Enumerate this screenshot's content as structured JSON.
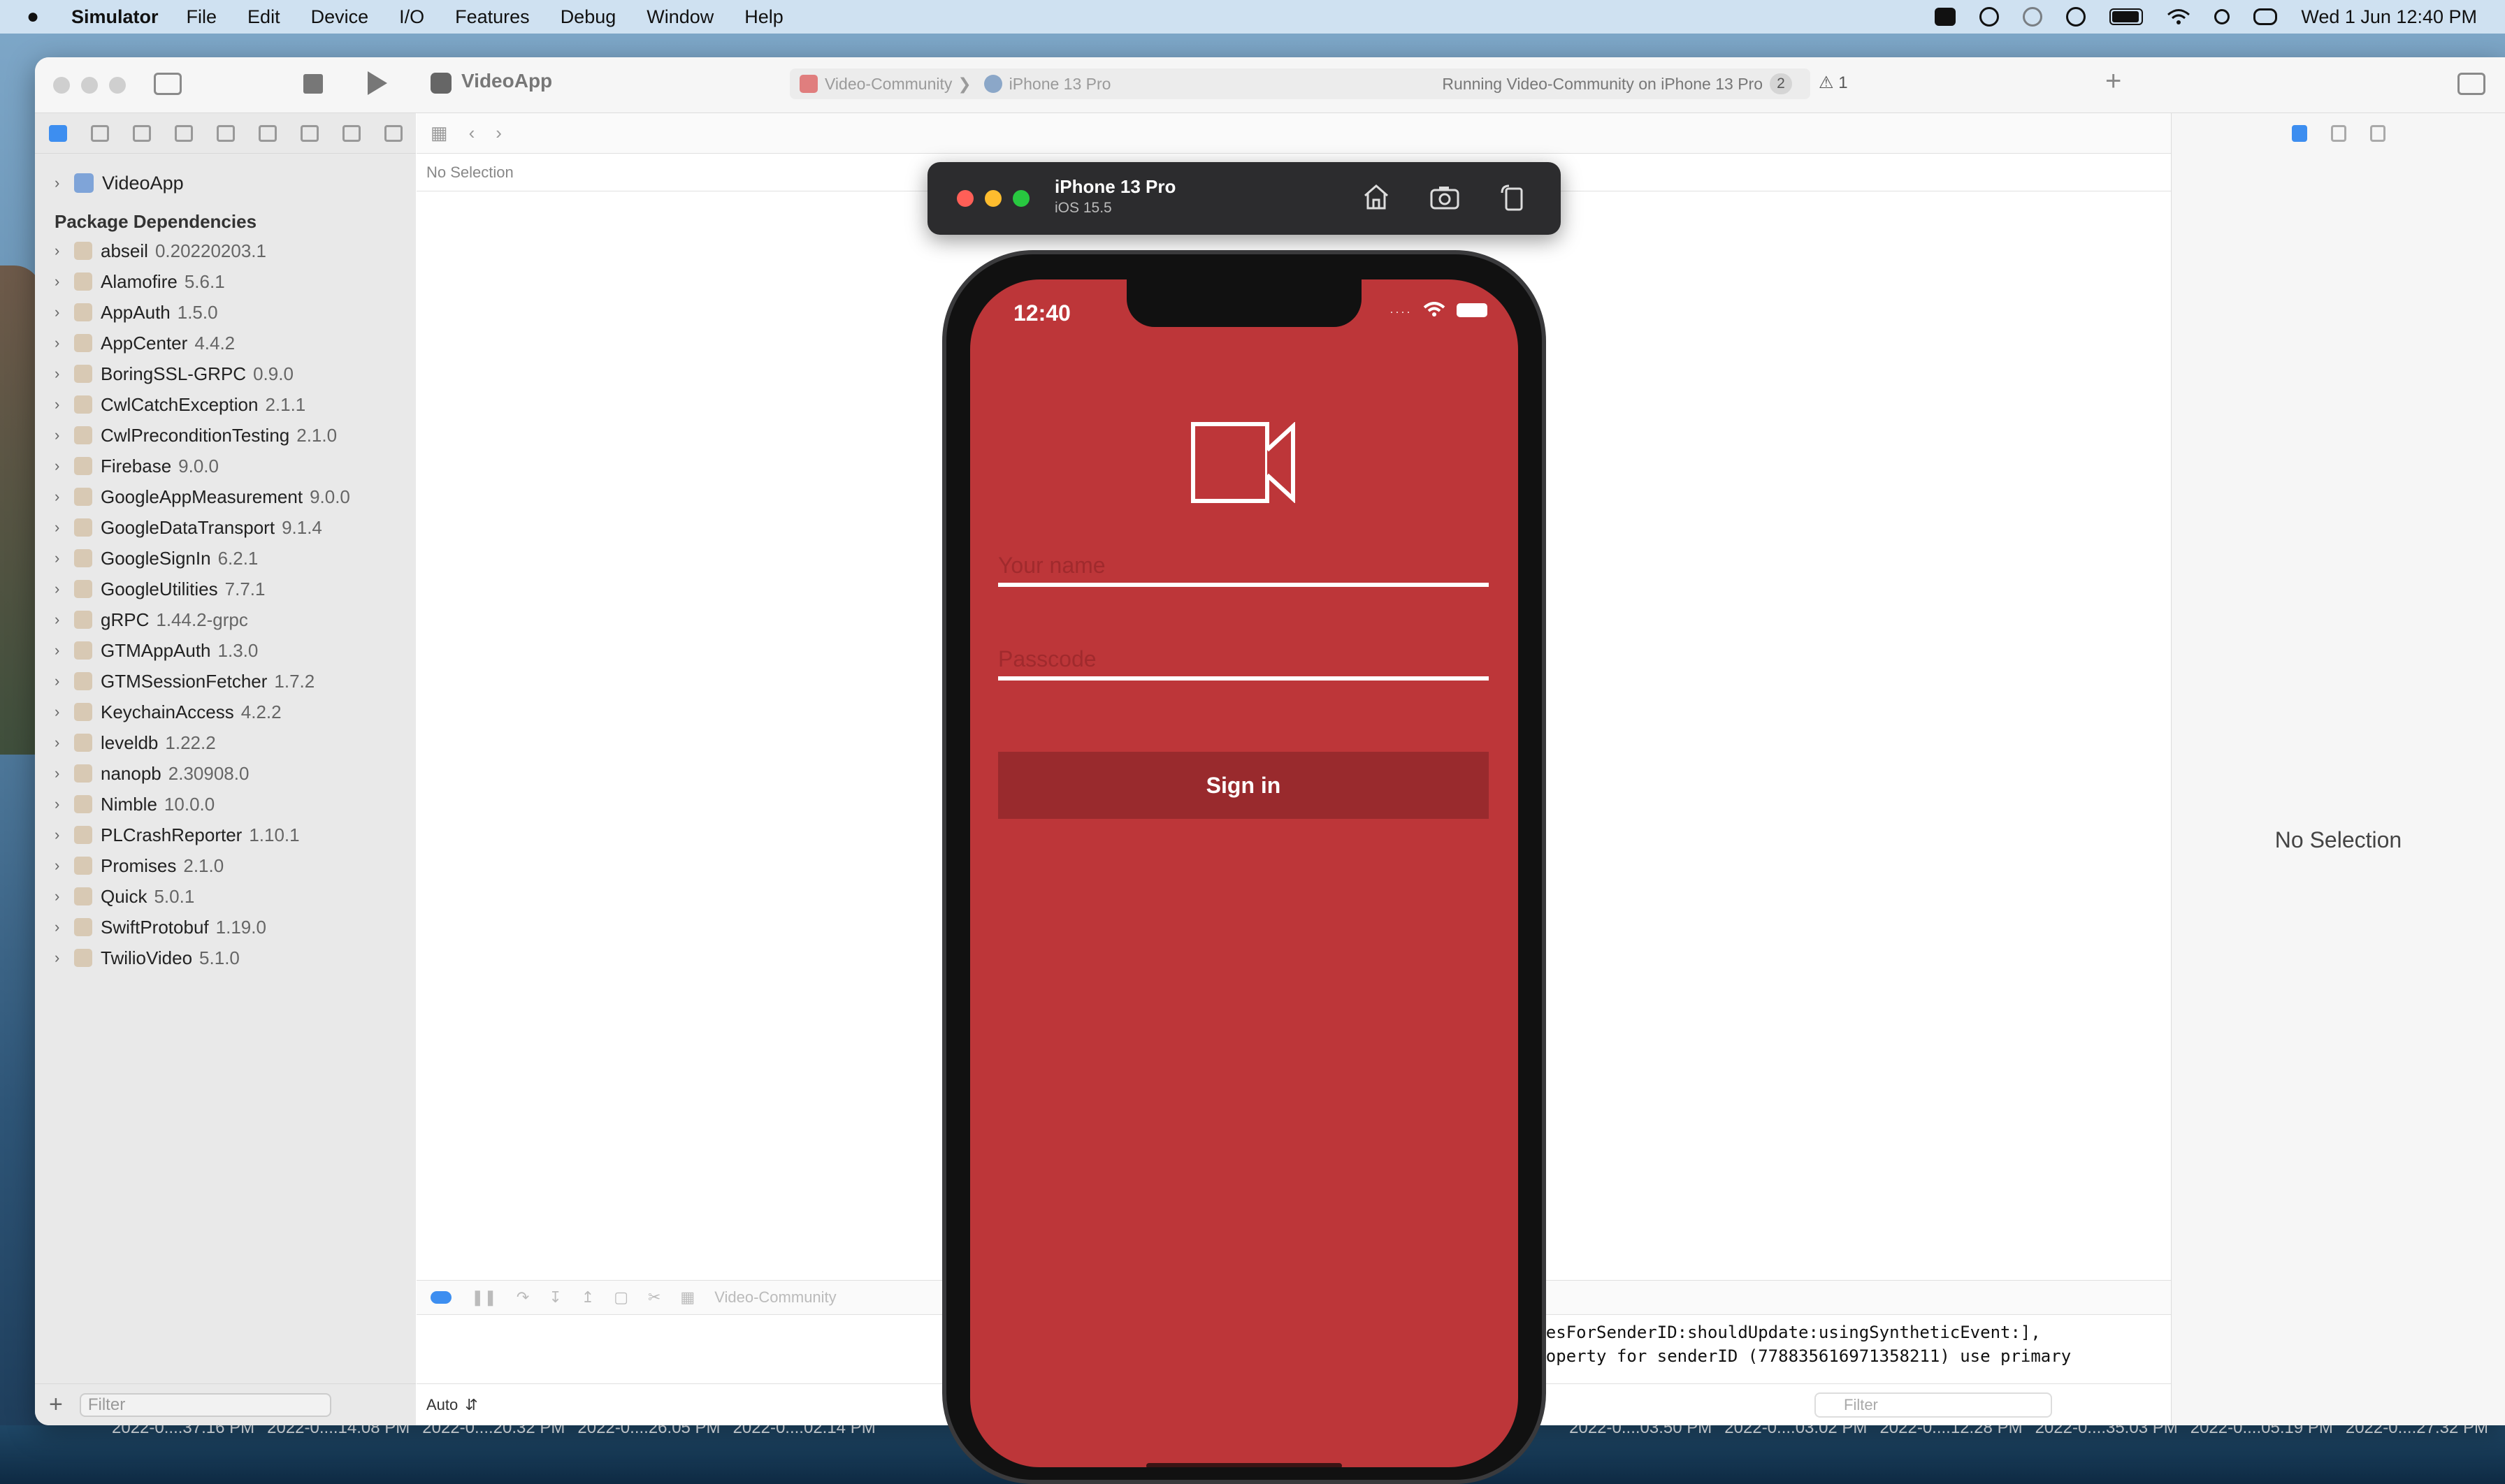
{
  "menubar": {
    "app_name": "Simulator",
    "menus": [
      "File",
      "Edit",
      "Device",
      "I/O",
      "Features",
      "Debug",
      "Window",
      "Help"
    ],
    "clock": "Wed 1 Jun  12:40 PM"
  },
  "xcode": {
    "project_name": "VideoApp",
    "scheme": "Video-Community",
    "device": "iPhone 13 Pro",
    "status": "Running Video-Community on iPhone 13 Pro",
    "status_badge": "2",
    "warning_count": "1",
    "editor_no_selection": "No Selection",
    "inspector_no_selection": "No Selection",
    "navigator": {
      "root": "VideoApp",
      "section": "Package Dependencies",
      "packages": [
        {
          "name": "abseil",
          "version": "0.20220203.1"
        },
        {
          "name": "Alamofire",
          "version": "5.6.1"
        },
        {
          "name": "AppAuth",
          "version": "1.5.0"
        },
        {
          "name": "AppCenter",
          "version": "4.4.2"
        },
        {
          "name": "BoringSSL-GRPC",
          "version": "0.9.0"
        },
        {
          "name": "CwlCatchException",
          "version": "2.1.1"
        },
        {
          "name": "CwlPreconditionTesting",
          "version": "2.1.0"
        },
        {
          "name": "Firebase",
          "version": "9.0.0"
        },
        {
          "name": "GoogleAppMeasurement",
          "version": "9.0.0"
        },
        {
          "name": "GoogleDataTransport",
          "version": "9.1.4"
        },
        {
          "name": "GoogleSignIn",
          "version": "6.2.1"
        },
        {
          "name": "GoogleUtilities",
          "version": "7.7.1"
        },
        {
          "name": "gRPC",
          "version": "1.44.2-grpc"
        },
        {
          "name": "GTMAppAuth",
          "version": "1.3.0"
        },
        {
          "name": "GTMSessionFetcher",
          "version": "1.7.2"
        },
        {
          "name": "KeychainAccess",
          "version": "4.2.2"
        },
        {
          "name": "leveldb",
          "version": "1.22.2"
        },
        {
          "name": "nanopb",
          "version": "2.30908.0"
        },
        {
          "name": "Nimble",
          "version": "10.0.0"
        },
        {
          "name": "PLCrashReporter",
          "version": "1.10.1"
        },
        {
          "name": "Promises",
          "version": "2.1.0"
        },
        {
          "name": "Quick",
          "version": "5.0.1"
        },
        {
          "name": "SwiftProtobuf",
          "version": "1.19.0"
        },
        {
          "name": "TwilioVideo",
          "version": "5.1.0"
        }
      ],
      "filter_placeholder": "Filter"
    },
    "debug_scheme": "Video-Community",
    "console_lines": [
      "ertiesForSenderID:shouldUpdate:usingSyntheticEvent:],",
      "e property for senderID (778835616971358211) use primary",
      "."
    ],
    "console_mode": "Auto",
    "console_filter_placeholder": "Filter"
  },
  "simulator": {
    "device_name": "iPhone 13 Pro",
    "os_version": "iOS 15.5"
  },
  "app_screen": {
    "status_time": "12:40",
    "name_placeholder": "Your name",
    "passcode_placeholder": "Passcode",
    "signin_label": "Sign in",
    "accent_color": "#bd3639"
  },
  "desktop_dates": [
    "2022-0....37.16 PM",
    "2022-0....14.08 PM",
    "2022-0....20.32 PM",
    "2022-0....26.05 PM",
    "2022-0....02.14 PM",
    "",
    "",
    "",
    "",
    "",
    "",
    "",
    "",
    "",
    "",
    "2022-0....03.50 PM",
    "2022-0....03.02 PM",
    "2022-0....12.28 PM",
    "2022-0....35.03 PM",
    "2022-0....05.19 PM",
    "2022-0....27.32 PM"
  ]
}
